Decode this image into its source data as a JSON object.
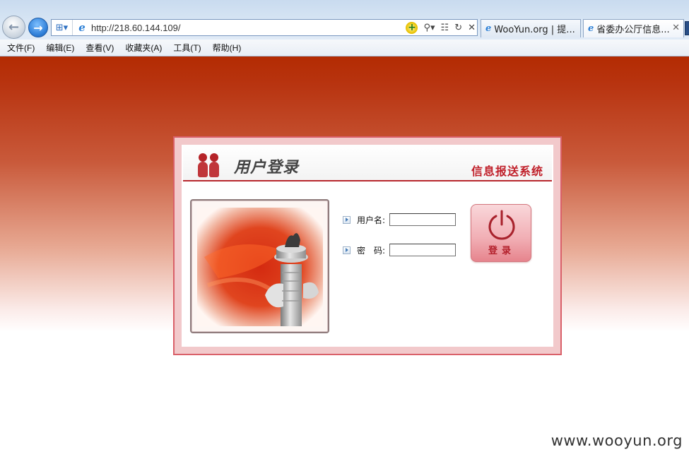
{
  "browser": {
    "address_url": "http://218.60.144.109/",
    "tabs": [
      {
        "label": "WooYun.org | 提..."
      },
      {
        "label": "省委办公厅信息..."
      }
    ],
    "menu": [
      "文件(F)",
      "编辑(E)",
      "查看(V)",
      "收藏夹(A)",
      "工具(T)",
      "帮助(H)"
    ]
  },
  "login": {
    "header_title": "用户登录",
    "system_name": "信息报送系统",
    "username_label": "用户名:",
    "password_label": "密　码:",
    "username_value": "",
    "password_value": "",
    "login_button": "登录"
  },
  "colors": {
    "banner_red": "#b32b02",
    "accent_red": "#c0202a",
    "panel_border": "#d96069"
  },
  "icons": {
    "back": "back-arrow-icon",
    "forward": "forward-arrow-icon",
    "power": "power-icon",
    "users": "users-icon"
  },
  "watermark": "www.wooyun.org"
}
